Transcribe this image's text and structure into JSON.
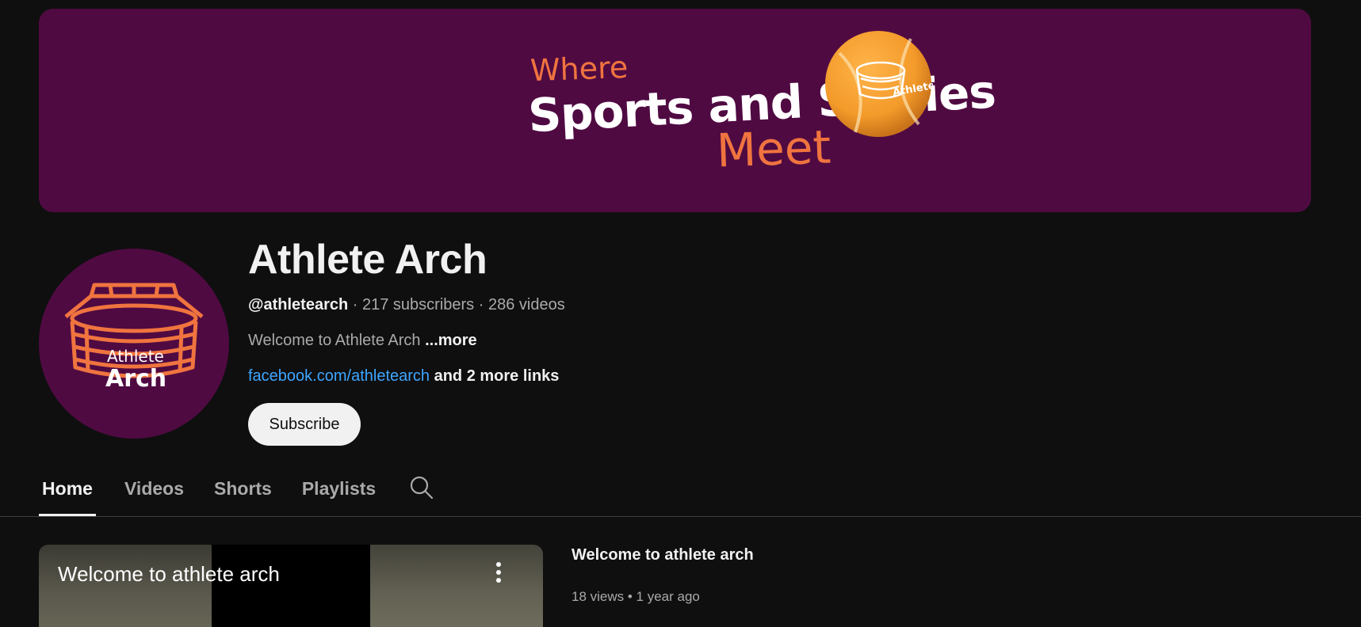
{
  "banner": {
    "line1": "Where",
    "line2": "Sports and Stories",
    "line3": "Meet",
    "ball_text": "Athlete Arch",
    "background_color": "#500a42",
    "accent_color": "#f0743f"
  },
  "avatar": {
    "text_top": "Athlete",
    "text_bottom": "Arch"
  },
  "channel": {
    "title": "Athlete Arch",
    "handle": "@athletearch",
    "subscribers": "217 subscribers",
    "videos": "286 videos",
    "separator": " · ",
    "description": "Welcome to Athlete Arch ",
    "description_more": "...more",
    "link": "facebook.com/athletearch",
    "more_links": " and 2 more links",
    "subscribe_label": "Subscribe"
  },
  "tabs": [
    {
      "label": "Home",
      "active": true
    },
    {
      "label": "Videos",
      "active": false
    },
    {
      "label": "Shorts",
      "active": false
    },
    {
      "label": "Playlists",
      "active": false
    }
  ],
  "featured": {
    "thumb_title": "Welcome to athlete arch",
    "title": "Welcome to athlete arch",
    "views": "18 views",
    "age": "1 year ago",
    "dot": " • "
  },
  "colors": {
    "background": "#0f0f0f",
    "text": "#f1f1f1",
    "secondary": "#aaaaaa",
    "link": "#3ea6ff"
  },
  "icons": {
    "search": "search-icon",
    "menu": "more-vert-icon"
  }
}
